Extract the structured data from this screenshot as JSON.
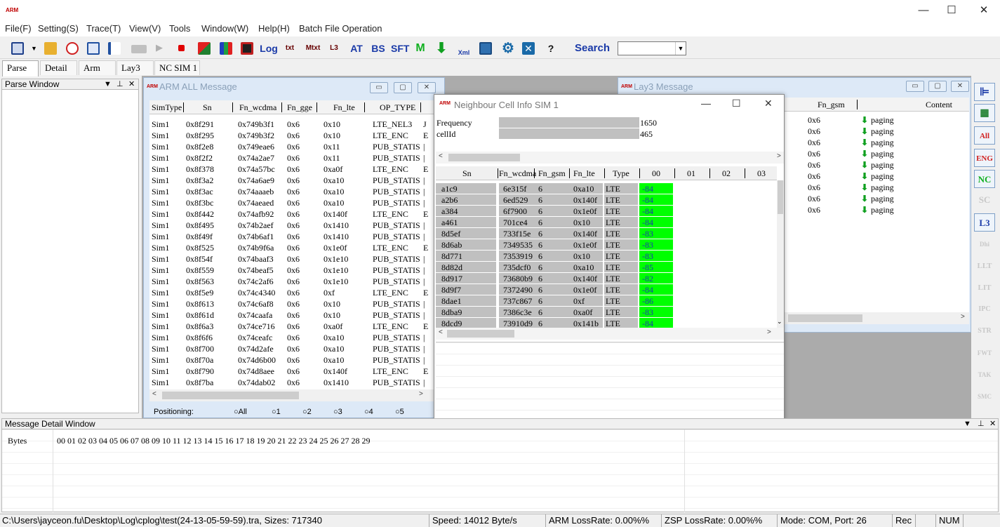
{
  "app": {
    "logo_text": "ARM"
  },
  "menu": [
    "File(F)",
    "Setting(S)",
    "Trace(T)",
    "View(V)",
    "Tools",
    "Window(W)",
    "Help(H)",
    "Batch File Operation"
  ],
  "toolbar": {
    "log_label": "Log",
    "txt_label": "txt",
    "mtxt_label": "Mtxt",
    "l3_label": "L3",
    "at_label": "AT",
    "bs_label": "BS",
    "sft_label": "SFT",
    "m_label": "M",
    "xml_label": "Xml",
    "help_label": "?",
    "search_label": "Search",
    "search_value": ""
  },
  "tabs": [
    "Parse",
    "Detail",
    "Arm",
    "Lay3",
    "NC SIM 1"
  ],
  "parse_window": {
    "title": "Parse Window"
  },
  "arm_all": {
    "title": "ARM ALL Message",
    "columns": [
      "SimType",
      "Sn",
      "Fn_wcdma",
      "Fn_gge",
      "Fn_lte",
      "OP_TYPE"
    ],
    "rows": [
      [
        "Sim1",
        "0x8f291",
        "0x749b3f1",
        "0x6",
        "0x10",
        "LTE_NEL3",
        "J"
      ],
      [
        "Sim1",
        "0x8f295",
        "0x749b3f2",
        "0x6",
        "0x10",
        "LTE_ENC",
        "E"
      ],
      [
        "Sim1",
        "0x8f2e8",
        "0x749eae6",
        "0x6",
        "0x11",
        "PUB_STATIS",
        "|"
      ],
      [
        "Sim1",
        "0x8f2f2",
        "0x74a2ae7",
        "0x6",
        "0x11",
        "PUB_STATIS",
        "|"
      ],
      [
        "Sim1",
        "0x8f378",
        "0x74a57bc",
        "0x6",
        "0xa0f",
        "LTE_ENC",
        "E"
      ],
      [
        "Sim1",
        "0x8f3a2",
        "0x74a6ae9",
        "0x6",
        "0xa10",
        "PUB_STATIS",
        "|"
      ],
      [
        "Sim1",
        "0x8f3ac",
        "0x74aaaeb",
        "0x6",
        "0xa10",
        "PUB_STATIS",
        "|"
      ],
      [
        "Sim1",
        "0x8f3bc",
        "0x74aeaed",
        "0x6",
        "0xa10",
        "PUB_STATIS",
        "|"
      ],
      [
        "Sim1",
        "0x8f442",
        "0x74afb92",
        "0x6",
        "0x140f",
        "LTE_ENC",
        "E"
      ],
      [
        "Sim1",
        "0x8f495",
        "0x74b2aef",
        "0x6",
        "0x1410",
        "PUB_STATIS",
        "|"
      ],
      [
        "Sim1",
        "0x8f49f",
        "0x74b6af1",
        "0x6",
        "0x1410",
        "PUB_STATIS",
        "|"
      ],
      [
        "Sim1",
        "0x8f525",
        "0x74b9f6a",
        "0x6",
        "0x1e0f",
        "LTE_ENC",
        "E"
      ],
      [
        "Sim1",
        "0x8f54f",
        "0x74baaf3",
        "0x6",
        "0x1e10",
        "PUB_STATIS",
        "|"
      ],
      [
        "Sim1",
        "0x8f559",
        "0x74beaf5",
        "0x6",
        "0x1e10",
        "PUB_STATIS",
        "|"
      ],
      [
        "Sim1",
        "0x8f563",
        "0x74c2af6",
        "0x6",
        "0x1e10",
        "PUB_STATIS",
        "|"
      ],
      [
        "Sim1",
        "0x8f5e9",
        "0x74c4340",
        "0x6",
        "0xf",
        "LTE_ENC",
        "E"
      ],
      [
        "Sim1",
        "0x8f613",
        "0x74c6af8",
        "0x6",
        "0x10",
        "PUB_STATIS",
        "|"
      ],
      [
        "Sim1",
        "0x8f61d",
        "0x74caafa",
        "0x6",
        "0x10",
        "PUB_STATIS",
        "|"
      ],
      [
        "Sim1",
        "0x8f6a3",
        "0x74ce716",
        "0x6",
        "0xa0f",
        "LTE_ENC",
        "E"
      ],
      [
        "Sim1",
        "0x8f6f6",
        "0x74ceafc",
        "0x6",
        "0xa10",
        "PUB_STATIS",
        "|"
      ],
      [
        "Sim1",
        "0x8f700",
        "0x74d2afe",
        "0x6",
        "0xa10",
        "PUB_STATIS",
        "|"
      ],
      [
        "Sim1",
        "0x8f70a",
        "0x74d6b00",
        "0x6",
        "0xa10",
        "PUB_STATIS",
        "|"
      ],
      [
        "Sim1",
        "0x8f790",
        "0x74d8aee",
        "0x6",
        "0x140f",
        "LTE_ENC",
        "E"
      ],
      [
        "Sim1",
        "0x8f7ba",
        "0x74dab02",
        "0x6",
        "0x1410",
        "PUB_STATIS",
        "|"
      ]
    ],
    "positioning_label": "Positioning:",
    "radio_labels": [
      "All",
      "1",
      "2",
      "3",
      "4",
      "5"
    ]
  },
  "lay3": {
    "title": "Lay3 Message",
    "columns": [
      "Fn_gsm",
      "Content"
    ],
    "rows": [
      [
        "0x6",
        "paging"
      ],
      [
        "0x6",
        "paging"
      ],
      [
        "0x6",
        "paging"
      ],
      [
        "0x6",
        "paging"
      ],
      [
        "0x6",
        "paging"
      ],
      [
        "0x6",
        "paging"
      ],
      [
        "0x6",
        "paging"
      ],
      [
        "0x6",
        "paging"
      ],
      [
        "0x6",
        "paging"
      ]
    ]
  },
  "nc": {
    "title": "Neighbour Cell Info SIM 1",
    "info": [
      {
        "label": "Frequency",
        "value": "1650"
      },
      {
        "label": "cellId",
        "value": "465"
      }
    ],
    "columns": [
      "Sn",
      "Fn_wcdma",
      "Fn_gsm",
      "Fn_lte",
      "Type",
      "00",
      "01",
      "02",
      "03"
    ],
    "rows": [
      [
        "a1c9",
        "6e315f",
        "6",
        "0xa10",
        "LTE",
        "-84"
      ],
      [
        "a2b6",
        "6ed529",
        "6",
        "0x140f",
        "LTE",
        "-84"
      ],
      [
        "a384",
        "6f7900",
        "6",
        "0x1e0f",
        "LTE",
        "-84"
      ],
      [
        "a461",
        "701ce4",
        "6",
        "0x10",
        "LTE",
        "-84"
      ],
      [
        "8d5ef",
        "733f15e",
        "6",
        "0x140f",
        "LTE",
        "-83"
      ],
      [
        "8d6ab",
        "7349535",
        "6",
        "0x1e0f",
        "LTE",
        "-83"
      ],
      [
        "8d771",
        "7353919",
        "6",
        "0x10",
        "LTE",
        "-83"
      ],
      [
        "8d82d",
        "735dcf0",
        "6",
        "0xa10",
        "LTE",
        "-85"
      ],
      [
        "8d917",
        "73680b9",
        "6",
        "0x140f",
        "LTE",
        "-82"
      ],
      [
        "8d9f7",
        "7372490",
        "6",
        "0x1e0f",
        "LTE",
        "-84"
      ],
      [
        "8dae1",
        "737c867",
        "6",
        "0xf",
        "LTE",
        "-86"
      ],
      [
        "8dba9",
        "7386c3e",
        "6",
        "0xa0f",
        "LTE",
        "-83"
      ],
      [
        "8dcd9",
        "73910d9",
        "6",
        "0x141b",
        "LTE",
        "-84"
      ]
    ],
    "highlight_color": "#00ff00"
  },
  "message_detail": {
    "title": "Message Detail Window",
    "bytes_label": "Bytes",
    "byte_header": "00 01 02 03 04 05 06 07 08 09 10 11 12 13 14 15 16 17 18 19 20 21 22 23 24 25 26 27 28 29"
  },
  "right_strip": [
    "All",
    "ENG",
    "NC",
    "SC",
    "L3",
    "Dhi",
    "LLT",
    "LIT",
    "IPC",
    "STR",
    "FWT",
    "TAK",
    "SMC"
  ],
  "status": {
    "path": "C:\\Users\\jayceon.fu\\Desktop\\Log\\cplog\\test(24-13-05-59-59).tra, Sizes: 717340",
    "speed": "Speed: 14012 Byte/s",
    "arm_loss": "ARM LossRate: 0.00%%",
    "zsp_loss": "ZSP LossRate: 0.00%%",
    "mode": "Mode: COM, Port: 26",
    "rec": "Rec",
    "num": "NUM"
  }
}
